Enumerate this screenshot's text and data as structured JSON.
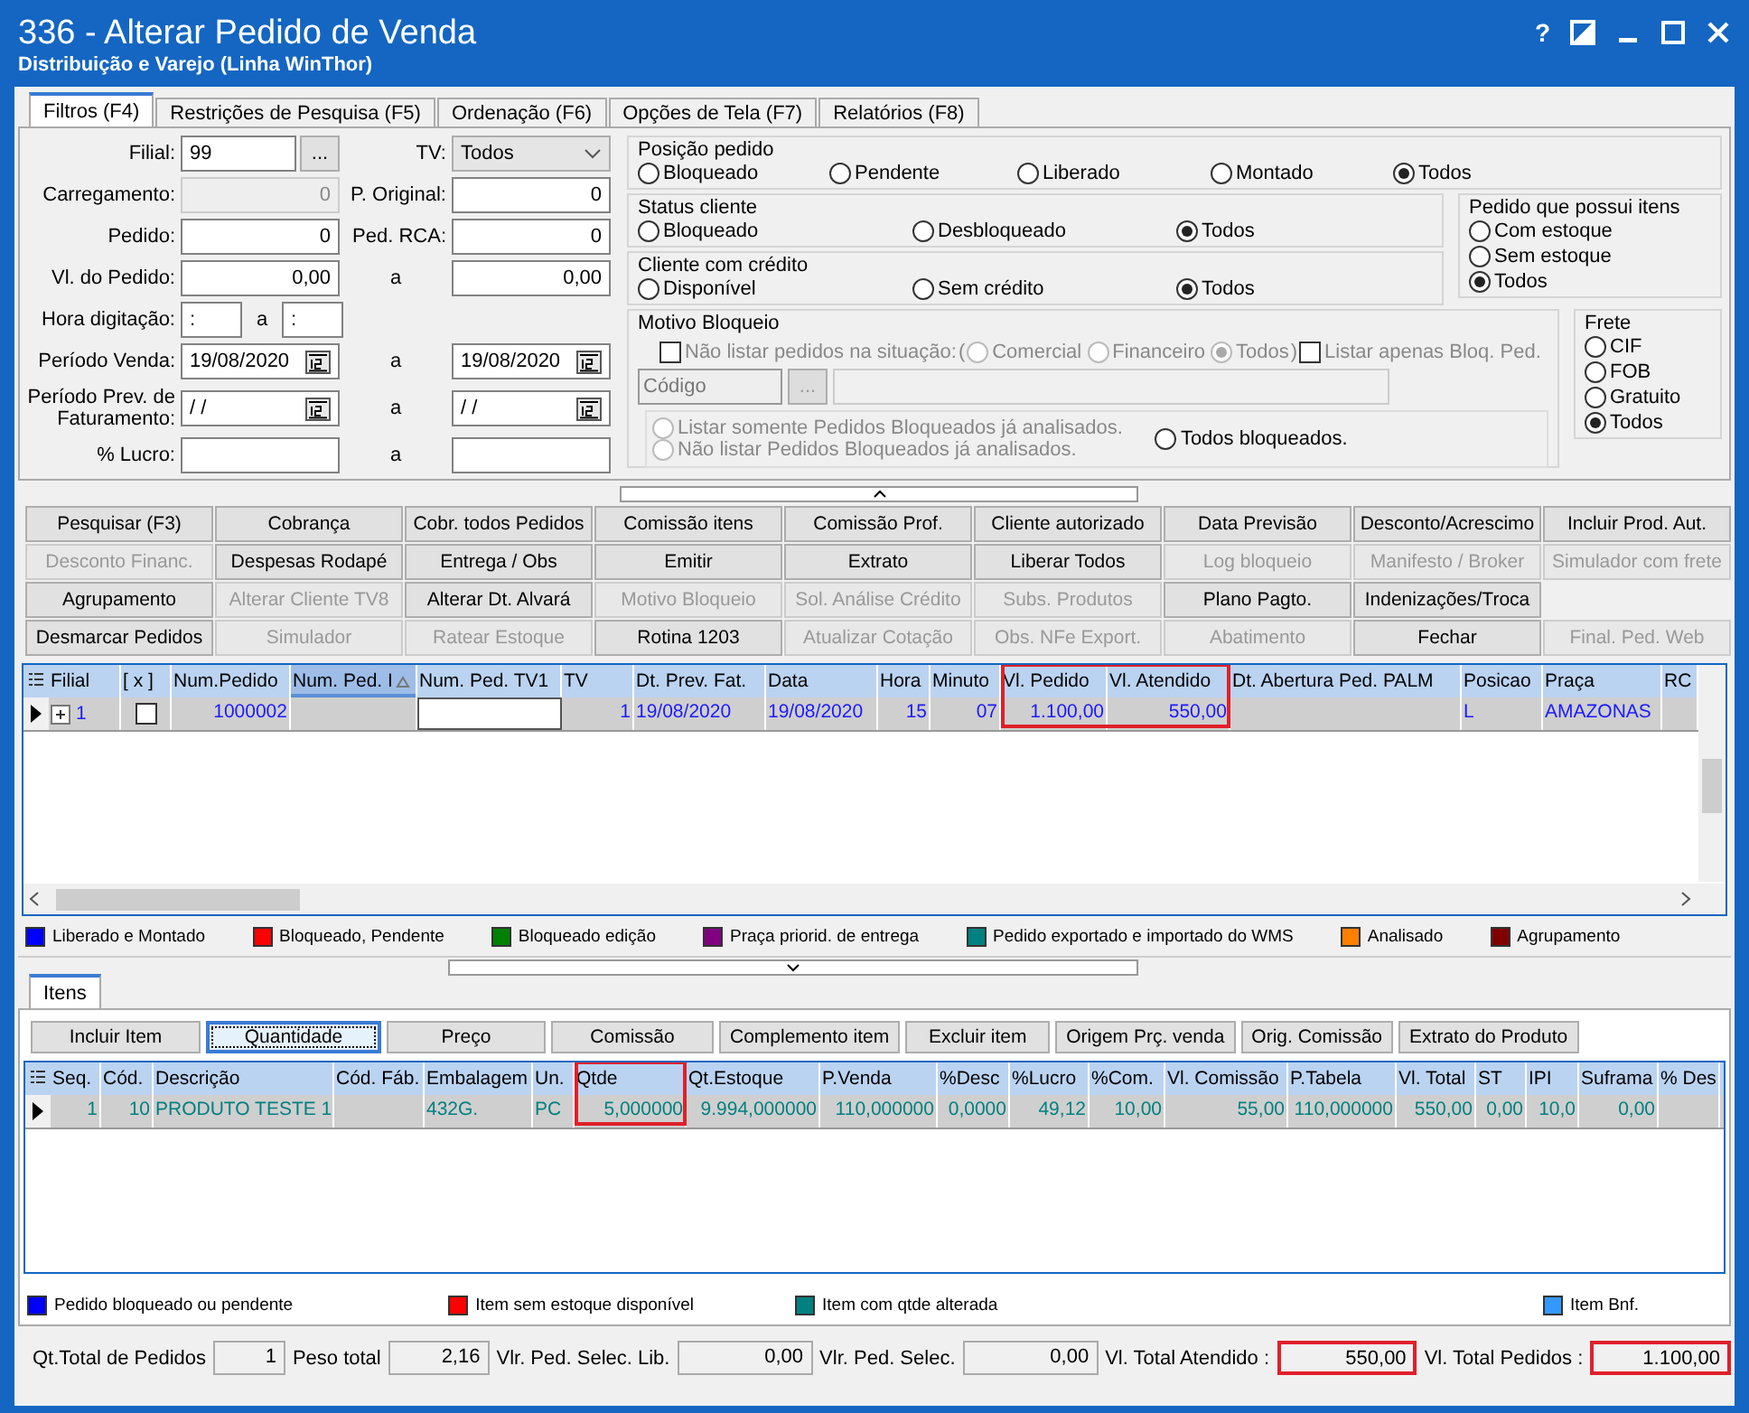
{
  "window": {
    "title": "336 - Alterar Pedido de Venda",
    "subtitle": "Distribuição e Varejo (Linha WinThor)",
    "controls": [
      {
        "kind": "help",
        "label": "?"
      },
      {
        "kind": "theme"
      },
      {
        "kind": "minimize"
      },
      {
        "kind": "maximize"
      },
      {
        "kind": "close"
      }
    ]
  },
  "tabs": [
    {
      "label": "Filtros (F4)",
      "selected": true
    },
    {
      "label": "Restrições de Pesquisa (F5)",
      "selected": false
    },
    {
      "label": "Ordenação (F6)",
      "selected": false
    },
    {
      "label": "Opções de Tela (F7)",
      "selected": false
    },
    {
      "label": "Relatórios (F8)",
      "selected": false
    }
  ],
  "filters": {
    "left_form": {
      "filial": {
        "label": "Filial:",
        "value": "99",
        "lookup": "..."
      },
      "tv": {
        "label": "TV:",
        "value": "Todos"
      },
      "rows": [
        {
          "label": "Carregamento:",
          "mid": "P. Original:",
          "from": {
            "kind": "number",
            "value": "0",
            "disabled": true
          },
          "to": {
            "kind": "number",
            "value": "0",
            "disabled": false
          }
        },
        {
          "label": "Pedido:",
          "mid": "Ped. RCA:",
          "from": {
            "kind": "number",
            "value": "0",
            "disabled": false
          },
          "to": {
            "kind": "number",
            "value": "0",
            "disabled": false
          }
        },
        {
          "label": "Vl. do Pedido:",
          "mid": "a",
          "from": {
            "kind": "number",
            "value": "0,00",
            "disabled": false
          },
          "to": {
            "kind": "number",
            "value": "0,00",
            "disabled": false
          }
        },
        {
          "label": "Hora digitação:",
          "mid": "a",
          "from": {
            "kind": "time",
            "value": ":",
            "disabled": false
          },
          "to": {
            "kind": "time",
            "value": ":",
            "disabled": false
          }
        },
        {
          "label": "Período Venda:",
          "mid": "a",
          "from": {
            "kind": "date",
            "value": "19/08/2020",
            "disabled": false
          },
          "to": {
            "kind": "date",
            "value": "19/08/2020",
            "disabled": false
          }
        },
        {
          "label": "Período Prev. de Faturamento:",
          "mid": "a",
          "from": {
            "kind": "date",
            "value": "/ /",
            "disabled": false
          },
          "to": {
            "kind": "date",
            "value": "/ /",
            "disabled": false
          }
        },
        {
          "label": "% Lucro:",
          "mid": "a",
          "from": {
            "kind": "number",
            "disabled": false
          },
          "to": {
            "kind": "number",
            "disabled": false
          }
        }
      ]
    },
    "posicao_pedido": {
      "title": "Posição pedido",
      "options": [
        {
          "label": "Bloqueado",
          "selected": false
        },
        {
          "label": "Pendente",
          "selected": false
        },
        {
          "label": "Liberado",
          "selected": false
        },
        {
          "label": "Montado",
          "selected": false
        },
        {
          "label": "Todos",
          "selected": true
        }
      ]
    },
    "status_cliente": {
      "title": "Status cliente",
      "options": [
        {
          "label": "Bloqueado",
          "selected": false
        },
        {
          "label": "Desbloqueado",
          "selected": false
        },
        {
          "label": "Todos",
          "selected": true
        }
      ]
    },
    "cliente_com_credito": {
      "title": "Cliente com crédito",
      "options": [
        {
          "label": "Disponível",
          "selected": false
        },
        {
          "label": "Sem crédito",
          "selected": false
        },
        {
          "label": "Todos",
          "selected": true
        }
      ]
    },
    "pedido_possui_itens": {
      "title": "Pedido que possui itens",
      "options": [
        {
          "label": "Com estoque",
          "selected": false
        },
        {
          "label": "Sem estoque",
          "selected": false
        },
        {
          "label": "Todos",
          "selected": true
        }
      ]
    },
    "motivo_bloqueio": {
      "title": "Motivo Bloqueio",
      "exclude_checkbox": {
        "label": "Não listar pedidos na situação:",
        "checked": false,
        "disabled": true
      },
      "bracket_open": "(",
      "situation_options": [
        {
          "label": "Comercial",
          "selected": false,
          "disabled": true
        },
        {
          "label": "Financeiro",
          "selected": false,
          "disabled": true
        },
        {
          "label": "Todos",
          "selected": true,
          "disabled": true
        }
      ],
      "bracket_close": ")",
      "only_blocked_checkbox": {
        "label": "Listar apenas Bloq. Ped.",
        "checked": false,
        "disabled": true
      },
      "code_field": {
        "placeholder": "Código"
      },
      "lookup_button": {
        "label": "...",
        "disabled": true
      },
      "analysis_options": [
        {
          "label": "Listar somente Pedidos Bloqueados já analisados.",
          "selected": false,
          "disabled": true
        },
        {
          "label": "Não listar Pedidos Bloqueados já analisados.",
          "selected": false,
          "disabled": true
        }
      ],
      "all_blocked": {
        "label": "Todos bloqueados.",
        "selected": false,
        "disabled": false
      }
    },
    "frete": {
      "title": "Frete",
      "options": [
        {
          "label": "CIF",
          "selected": false
        },
        {
          "label": "FOB",
          "selected": false
        },
        {
          "label": "Gratuito",
          "selected": false
        },
        {
          "label": "Todos",
          "selected": true
        }
      ]
    }
  },
  "button_rows": [
    [
      {
        "label": "Pesquisar (F3)",
        "disabled": false
      },
      {
        "label": "Cobrança",
        "disabled": false
      },
      {
        "label": "Cobr. todos Pedidos",
        "disabled": false
      },
      {
        "label": "Comissão itens",
        "disabled": false
      },
      {
        "label": "Comissão Prof.",
        "disabled": false
      },
      {
        "label": "Cliente autorizado",
        "disabled": false
      },
      {
        "label": "Data Previsão",
        "disabled": false
      },
      {
        "label": "Desconto/Acrescimo",
        "disabled": false
      },
      {
        "label": "Incluir Prod. Aut.",
        "disabled": false
      }
    ],
    [
      {
        "label": "Desconto Financ.",
        "disabled": true
      },
      {
        "label": "Despesas Rodapé",
        "disabled": false
      },
      {
        "label": "Entrega / Obs",
        "disabled": false
      },
      {
        "label": "Emitir",
        "disabled": false
      },
      {
        "label": "Extrato",
        "disabled": false
      },
      {
        "label": "Liberar Todos",
        "disabled": false
      },
      {
        "label": "Log bloqueio",
        "disabled": true
      },
      {
        "label": "Manifesto / Broker",
        "disabled": true
      },
      {
        "label": "Simulador com frete",
        "disabled": true
      }
    ],
    [
      {
        "label": "Agrupamento",
        "disabled": false
      },
      {
        "label": "Alterar Cliente TV8",
        "disabled": true
      },
      {
        "label": "Alterar Dt. Alvará",
        "disabled": false
      },
      {
        "label": "Motivo Bloqueio",
        "disabled": true
      },
      {
        "label": "Sol. Análise Crédito",
        "disabled": true
      },
      {
        "label": "Subs. Produtos",
        "disabled": true
      },
      {
        "label": "Plano Pagto.",
        "disabled": false
      },
      {
        "label": "Indenizações/Troca",
        "disabled": false
      }
    ],
    [
      {
        "label": "Desmarcar Pedidos",
        "disabled": false
      },
      {
        "label": "Simulador",
        "disabled": true
      },
      {
        "label": "Ratear Estoque",
        "disabled": true
      },
      {
        "label": "Rotina 1203",
        "disabled": false
      },
      {
        "label": "Atualizar Cotação",
        "disabled": true
      },
      {
        "label": "Obs. NFe Export.",
        "disabled": true
      },
      {
        "label": "Abatimento",
        "disabled": true
      },
      {
        "label": "Fechar",
        "disabled": false
      },
      {
        "label": "Final. Ped. Web",
        "disabled": true
      }
    ]
  ],
  "orders": {
    "columns": [
      {
        "label": "Filial",
        "sorted": false,
        "highlighted": false
      },
      {
        "label": "[ x ]",
        "sorted": false,
        "highlighted": false
      },
      {
        "label": "Num.Pedido",
        "sorted": false,
        "highlighted": false
      },
      {
        "label": "Num. Ped. I",
        "sorted": true,
        "highlighted": false
      },
      {
        "label": "Num. Ped. TV1",
        "sorted": false,
        "highlighted": false
      },
      {
        "label": "TV",
        "sorted": false,
        "highlighted": false
      },
      {
        "label": "Dt. Prev. Fat.",
        "sorted": false,
        "highlighted": false
      },
      {
        "label": "Data",
        "sorted": false,
        "highlighted": false
      },
      {
        "label": "Hora",
        "sorted": false,
        "highlighted": false
      },
      {
        "label": "Minuto",
        "sorted": false,
        "highlighted": false
      },
      {
        "label": "Vl. Pedido",
        "sorted": false,
        "highlighted": true
      },
      {
        "label": "Vl. Atendido",
        "sorted": false,
        "highlighted": true
      },
      {
        "label": "Dt. Abertura Ped. PALM",
        "sorted": false,
        "highlighted": false
      },
      {
        "label": "Posicao",
        "sorted": false,
        "highlighted": false
      },
      {
        "label": "Praça",
        "sorted": false,
        "highlighted": false
      },
      {
        "label": "RC",
        "sorted": false,
        "highlighted": false
      }
    ],
    "rows": [
      {
        "selected": true,
        "cells": [
          {
            "kind": "expand",
            "text": "1",
            "expanded": false
          },
          {
            "kind": "checkbox",
            "checked": false
          },
          {
            "kind": "text",
            "text": "1000002"
          },
          {
            "kind": "empty"
          },
          {
            "kind": "input"
          },
          {
            "kind": "text",
            "text": "1"
          },
          {
            "kind": "text",
            "text": "19/08/2020"
          },
          {
            "kind": "text",
            "text": "19/08/2020"
          },
          {
            "kind": "text",
            "text": "15"
          },
          {
            "kind": "text",
            "text": "07"
          },
          {
            "kind": "text",
            "text": "1.100,00"
          },
          {
            "kind": "text",
            "text": "550,00"
          },
          {
            "kind": "empty"
          },
          {
            "kind": "text",
            "text": "L"
          },
          {
            "kind": "text",
            "text": "AMAZONAS"
          },
          {
            "kind": "empty"
          }
        ]
      }
    ]
  },
  "orders_legend": [
    {
      "label": "Liberado e Montado",
      "color": "#0000ff"
    },
    {
      "label": "Bloqueado, Pendente",
      "color": "#ff0000"
    },
    {
      "label": "Bloqueado edição",
      "color": "#008000"
    },
    {
      "label": "Praça priorid. de entrega",
      "color": "#800080"
    },
    {
      "label": "Pedido exportado e importado do WMS",
      "color": "#008080"
    },
    {
      "label": "Analisado",
      "color": "#ff8000"
    },
    {
      "label": "Agrupamento",
      "color": "#800000"
    }
  ],
  "items_tab": {
    "label": "Itens",
    "selected": true
  },
  "items_buttons": [
    {
      "label": "Incluir Item",
      "focused": false
    },
    {
      "label": "Quantidade",
      "focused": true
    },
    {
      "label": "Preço",
      "focused": false
    },
    {
      "label": "Comissão",
      "focused": false
    },
    {
      "label": "Complemento item",
      "focused": false
    },
    {
      "label": "Excluir item",
      "focused": false
    },
    {
      "label": "Origem Prç. venda",
      "focused": false
    },
    {
      "label": "Orig. Comissão",
      "focused": false
    },
    {
      "label": "Extrato do Produto",
      "focused": false
    }
  ],
  "items": {
    "columns": [
      {
        "label": "Seq.",
        "highlighted": false
      },
      {
        "label": "Cód.",
        "highlighted": false
      },
      {
        "label": "Descrição",
        "highlighted": false
      },
      {
        "label": "Cód. Fáb.",
        "highlighted": false
      },
      {
        "label": "Embalagem",
        "highlighted": false
      },
      {
        "label": "Un.",
        "highlighted": false
      },
      {
        "label": "Qtde",
        "highlighted": true
      },
      {
        "label": "Qt.Estoque",
        "highlighted": false
      },
      {
        "label": "P.Venda",
        "highlighted": false
      },
      {
        "label": "%Desc",
        "highlighted": false
      },
      {
        "label": "%Lucro",
        "highlighted": false
      },
      {
        "label": "%Com.",
        "highlighted": false
      },
      {
        "label": "Vl. Comissão",
        "highlighted": false
      },
      {
        "label": "P.Tabela",
        "highlighted": false
      },
      {
        "label": "Vl. Total",
        "highlighted": false
      },
      {
        "label": "ST",
        "highlighted": false
      },
      {
        "label": "IPI",
        "highlighted": false
      },
      {
        "label": "Suframa",
        "highlighted": false
      },
      {
        "label": "% Des",
        "highlighted": false
      }
    ],
    "rows": [
      {
        "selected": true,
        "cells": [
          "1",
          "10",
          "PRODUTO TESTE 1",
          null,
          "432G.",
          "PC",
          "5,000000",
          "9.994,000000",
          "110,000000",
          "0,0000",
          "49,12",
          "10,00",
          "55,00",
          "110,000000",
          "550,00",
          "0,00",
          "10,0",
          "0,00",
          null
        ]
      }
    ]
  },
  "items_legend": [
    {
      "label": "Pedido bloqueado ou pendente",
      "color": "#0000ff"
    },
    {
      "label": "Item sem estoque disponível",
      "color": "#ff0000"
    },
    {
      "label": "Item com qtde alterada",
      "color": "#008080"
    },
    {
      "label": "Item Bnf.",
      "color": "#3399ff"
    }
  ],
  "totals": [
    {
      "label": "Qt.Total de Pedidos",
      "value": "1",
      "highlighted": false
    },
    {
      "label": "Peso total",
      "value": "2,16",
      "highlighted": false
    },
    {
      "label": "Vlr. Ped. Selec. Lib.",
      "value": "0,00",
      "highlighted": false
    },
    {
      "label": "Vlr. Ped. Selec.",
      "value": "0,00",
      "highlighted": false
    },
    {
      "label": "Vl. Total Atendido :",
      "value": "550,00",
      "highlighted": true
    },
    {
      "label": "Vl. Total Pedidos :",
      "value": "1.100,00",
      "highlighted": true
    }
  ]
}
